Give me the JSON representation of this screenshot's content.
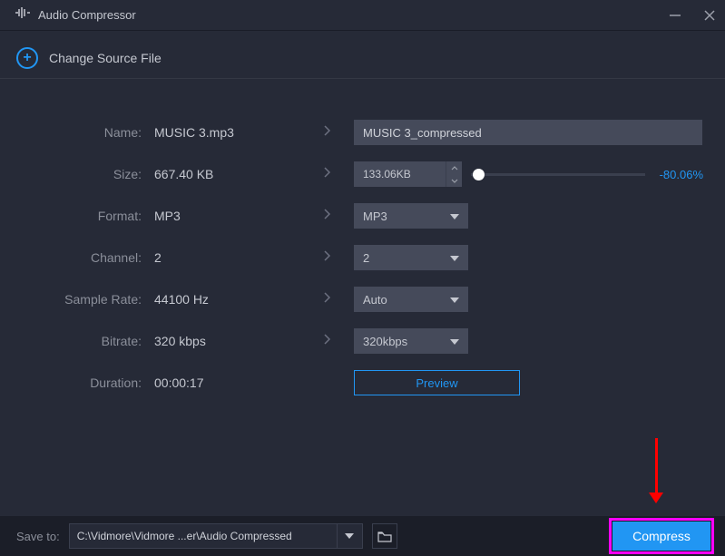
{
  "titlebar": {
    "title": "Audio Compressor"
  },
  "changeSource": {
    "label": "Change Source File"
  },
  "form": {
    "name": {
      "label": "Name:",
      "value": "MUSIC 3.mp3",
      "input_value": "MUSIC 3_compressed"
    },
    "size": {
      "label": "Size:",
      "value": "667.40 KB",
      "spinner_value": "133.06KB",
      "percent": "-80.06%"
    },
    "format": {
      "label": "Format:",
      "value": "MP3",
      "selected": "MP3"
    },
    "channel": {
      "label": "Channel:",
      "value": "2",
      "selected": "2"
    },
    "sampleRate": {
      "label": "Sample Rate:",
      "value": "44100 Hz",
      "selected": "Auto"
    },
    "bitrate": {
      "label": "Bitrate:",
      "value": "320 kbps",
      "selected": "320kbps"
    },
    "duration": {
      "label": "Duration:",
      "value": "00:00:17"
    },
    "preview": "Preview"
  },
  "footer": {
    "saveToLabel": "Save to:",
    "path": "C:\\Vidmore\\Vidmore ...er\\Audio Compressed",
    "compress": "Compress"
  }
}
